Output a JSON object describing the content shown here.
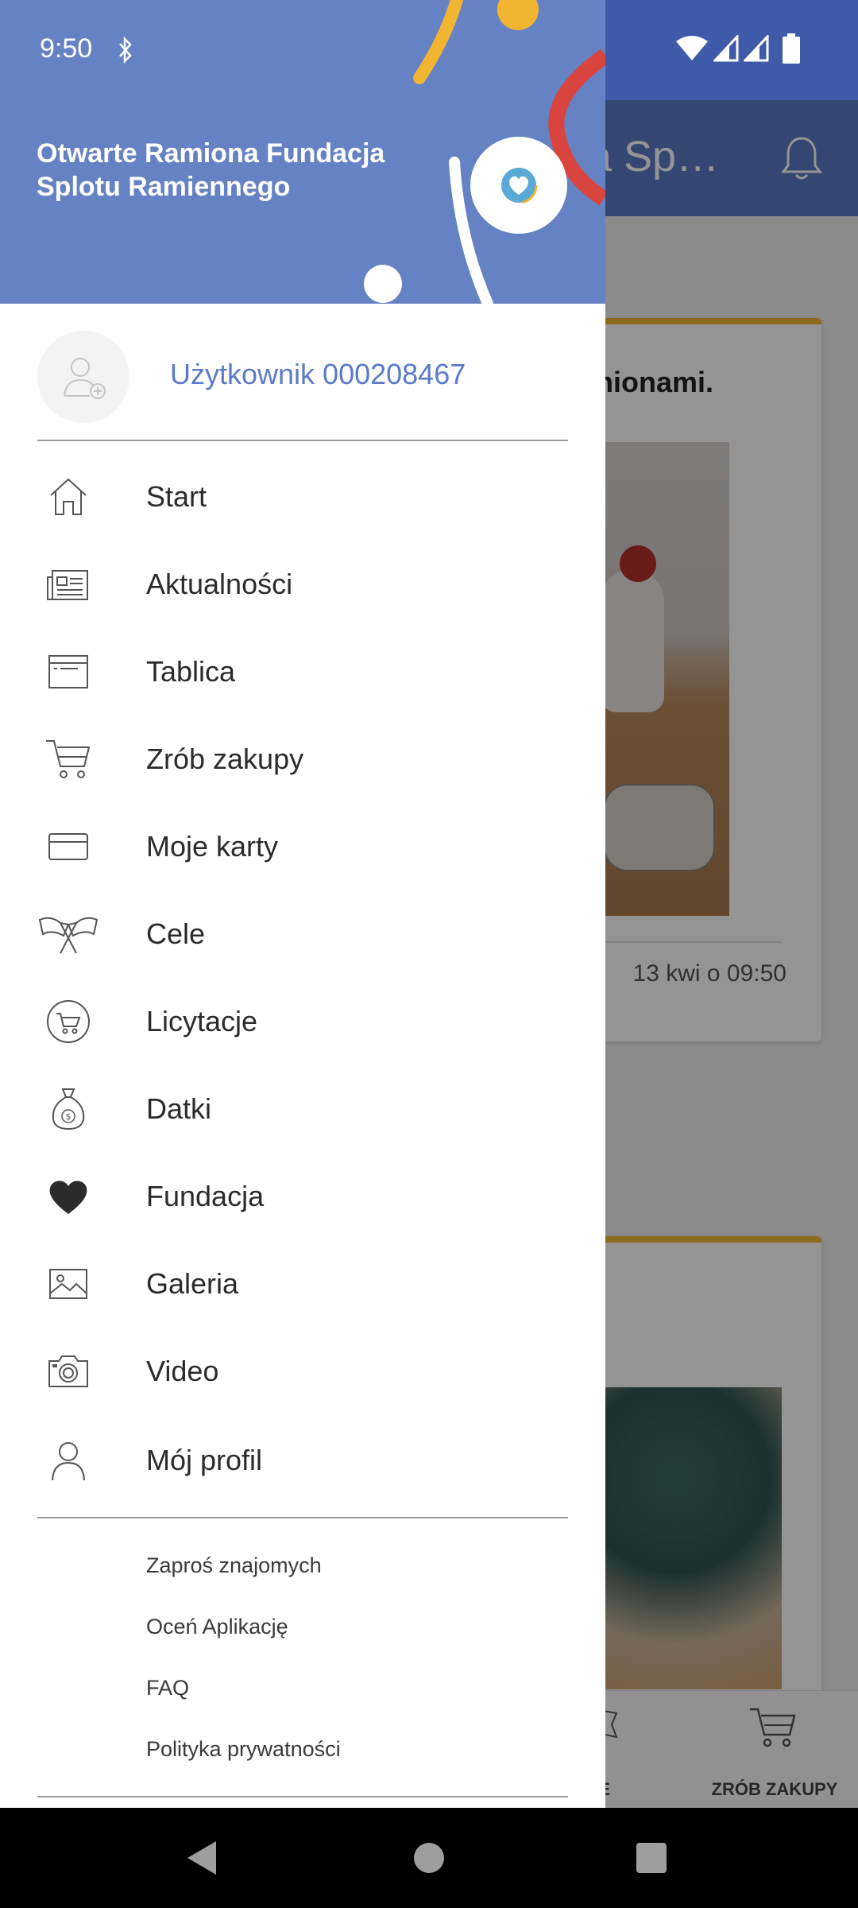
{
  "status_bar": {
    "time": "9:50"
  },
  "background_screen": {
    "appbar_title_fragment": "a Sp…",
    "card_1": {
      "title_fragment": "mionami.",
      "date": "13 kwi o 09:50"
    },
    "bottom_nav": {
      "cele_label_fragment": "LE",
      "cart_label": "ZRÓB ZAKUPY"
    }
  },
  "drawer": {
    "organization_name": "Otwarte Ramiona Fundacja Splotu Ramiennego",
    "user_name": "Użytkownik 000208467",
    "menu": [
      {
        "label": "Start",
        "icon": "home-icon"
      },
      {
        "label": "Aktualności",
        "icon": "newspaper-icon"
      },
      {
        "label": "Tablica",
        "icon": "board-icon"
      },
      {
        "label": "Zrób zakupy",
        "icon": "cart-icon"
      },
      {
        "label": "Moje karty",
        "icon": "card-icon"
      },
      {
        "label": "Cele",
        "icon": "flags-icon"
      },
      {
        "label": "Licytacje",
        "icon": "auction-cart-icon"
      },
      {
        "label": "Datki",
        "icon": "money-bag-icon"
      },
      {
        "label": "Fundacja",
        "icon": "heart-icon"
      },
      {
        "label": "Galeria",
        "icon": "image-icon"
      },
      {
        "label": "Video",
        "icon": "camera-icon"
      },
      {
        "label": "Mój profil",
        "icon": "person-icon"
      }
    ],
    "secondary": [
      {
        "label": "Zaproś znajomych"
      },
      {
        "label": "Oceń Aplikację"
      },
      {
        "label": "FAQ"
      },
      {
        "label": "Polityka prywatności"
      }
    ]
  },
  "colors": {
    "header_blue": "#6583c4",
    "accent_blue": "#5b7ac7",
    "statusbar_blue": "#3f5aa8",
    "card_accent_yellow": "#f2b531",
    "deco_red": "#d9443f",
    "deco_yellow": "#f2b531"
  }
}
